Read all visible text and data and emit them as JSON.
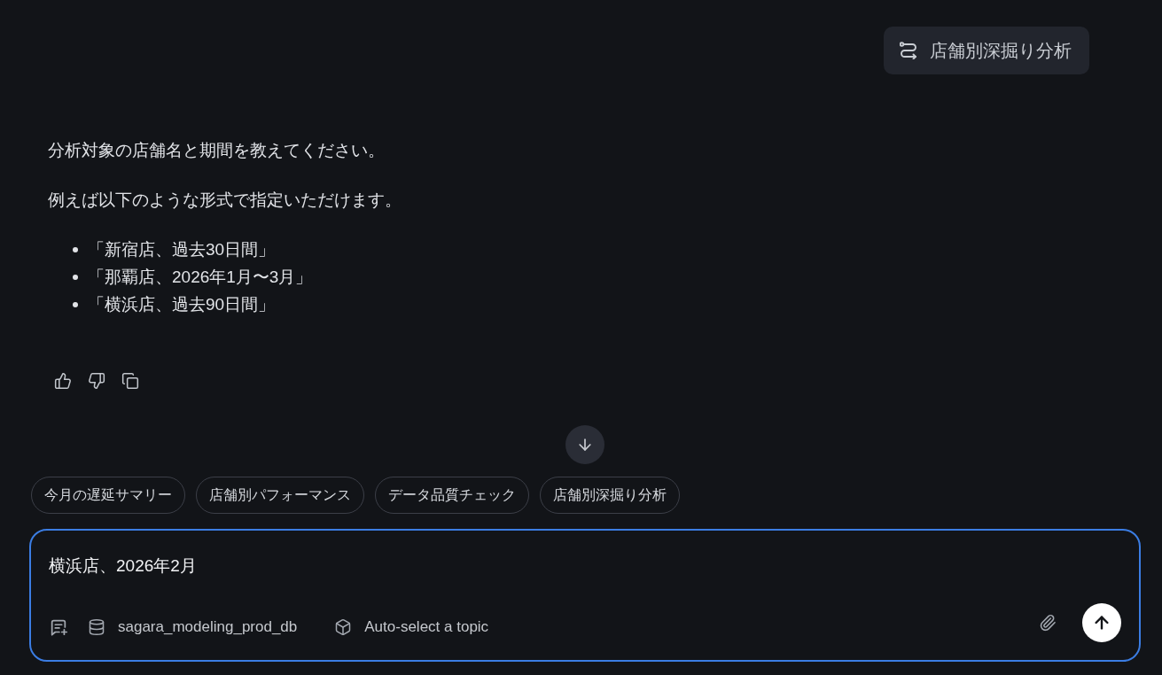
{
  "user_message": {
    "text": "店舗別深掘り分析"
  },
  "assistant_message": {
    "paragraphs": [
      "分析対象の店舗名と期間を教えてください。",
      "例えば以下のような形式で指定いただけます。"
    ],
    "list_items": [
      "「新宿店、過去30日間」",
      "「那覇店、2026年1月〜3月」",
      "「横浜店、過去90日間」"
    ]
  },
  "suggestions": [
    {
      "label": "今月の遅延サマリー"
    },
    {
      "label": "店舗別パフォーマンス"
    },
    {
      "label": "データ品質チェック"
    },
    {
      "label": "店舗別深掘り分析"
    }
  ],
  "composer": {
    "value": "横浜店、2026年2月",
    "focused": true,
    "database": "sagara_modeling_prod_db",
    "topic": "Auto-select a topic"
  }
}
